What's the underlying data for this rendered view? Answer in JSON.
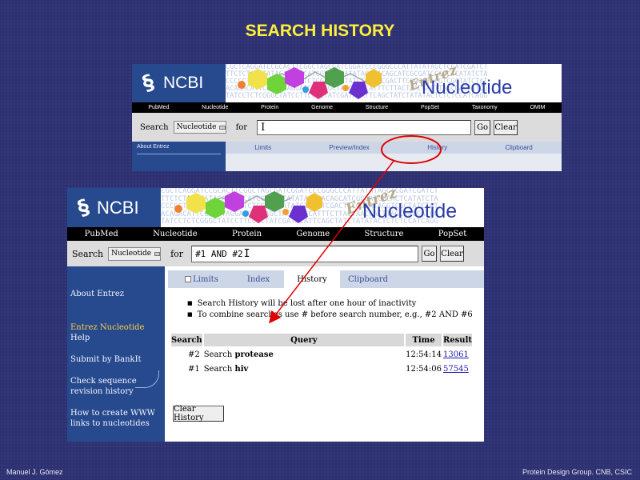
{
  "slide": {
    "title": "SEARCH HISTORY",
    "footer_left": "Manuel J. Gómez",
    "footer_right": "Protein Design Group. CNB, CSIC"
  },
  "colors": {
    "background": "#2e3170",
    "title": "#ffef3a",
    "ncbi_blue": "#274a8e",
    "annotation_red": "#e00000",
    "tab_bg": "#ccd6e6",
    "link": "#1a1aaa"
  },
  "banner": {
    "logo_text": "NCBI",
    "logo_icon": "dna-helix-icon",
    "entrez_text": "Entrez",
    "product_text": "Nucleotide",
    "sequence_lines": [
      "CGCTCAGGATCCGCACTTCGGCTAGCGATCGGATCCCGGGCCCATTATATAGCTCGATCGATCT",
      "TTCTCTATATATACATCGGCATCGTATCTATATACAGACAGCATCGCGATCGCACTCATATCTA",
      "CCCCCTATATATAGCTATCTCTCGAGCTATATCTGGATCGACTTCGGCATACGTCGCTATCTAT",
      "ACAGACATTCCATTTAGGAGGCCTAGCTAGCTAGCATTTCTTACTAACGACTTAGCGAGCATCG",
      "TATCCTCTCGGGCTATCCTTCCCCTATCGATACATTCAGCTATCTATATACTCTCTCCATCAGG"
    ]
  },
  "top_screenshot": {
    "nav": [
      "PubMed",
      "Nucleotide",
      "Protein",
      "Genome",
      "Structure",
      "PopSet",
      "Taxonomy",
      "OMIM"
    ],
    "search_label": "Search",
    "database": "Nucleotide",
    "for_label": "for",
    "query_value": "",
    "go_label": "Go",
    "clear_label": "Clear",
    "tabs": [
      "Limits",
      "Preview/Index",
      "History",
      "Clipboard"
    ],
    "side_link": "About Entrez"
  },
  "main_screenshot": {
    "nav": [
      "PubMed",
      "Nucleotide",
      "Protein",
      "Genome",
      "Structure",
      "PopSet"
    ],
    "search_label": "Search",
    "database": "Nucleotide",
    "for_label": "for",
    "query_value": "#1 AND #2",
    "go_label": "Go",
    "clear_label": "Clear",
    "tabs": [
      "Limits",
      "Index",
      "History",
      "Clipboard"
    ],
    "active_tab": "History",
    "sidebar": {
      "about": "About Entrez",
      "entrez_nucleotide": "Entrez Nucleotide",
      "help": "Help",
      "submit": "Submit by BankIt",
      "check": "Check sequence revision history",
      "how": "How to create WWW links to nucleotides"
    },
    "notes": [
      "Search History will be lost after one hour of inactivity",
      "To combine searches use # before search number, e.g., #2 AND #6"
    ],
    "history_table": {
      "headers": [
        "Search",
        "Query",
        "Time",
        "Result"
      ],
      "rows": [
        {
          "num": "#2",
          "prefix": "Search",
          "term": "protease",
          "time": "12:54:14",
          "result": "13061"
        },
        {
          "num": "#1",
          "prefix": "Search",
          "term": "hiv",
          "time": "12:54:06",
          "result": "57545"
        }
      ]
    },
    "clear_history_label": "Clear History"
  }
}
